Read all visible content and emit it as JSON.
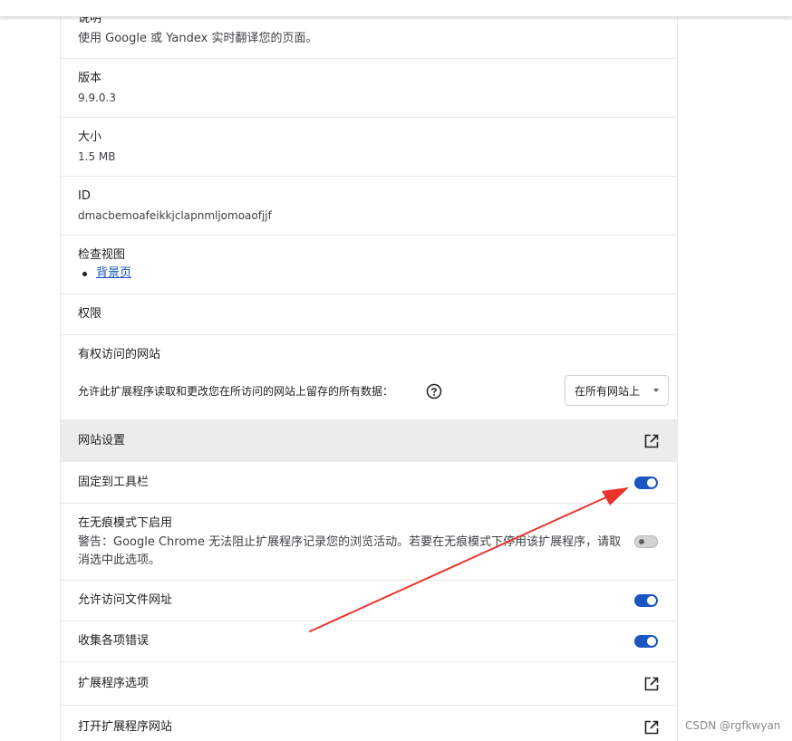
{
  "description": {
    "label": "说明",
    "value": "使用 Google 或 Yandex 实时翻译您的页面。"
  },
  "version": {
    "label": "版本",
    "value": "9.9.0.3"
  },
  "size": {
    "label": "大小",
    "value": "1.5 MB"
  },
  "id": {
    "label": "ID",
    "value": "dmacbemoafeikkjclapnmljomoaofjjf"
  },
  "inspect_views": {
    "label": "检查视图",
    "link": "背景页"
  },
  "permissions": {
    "label": "权限"
  },
  "site_access": {
    "label": "有权访问的网站",
    "desc": "允许此扩展程序读取和更改您在所访问的网站上留存的所有数据：",
    "select_value": "在所有网站上"
  },
  "site_settings": {
    "label": "网站设置"
  },
  "pin_toolbar": {
    "label": "固定到工具栏",
    "enabled": true
  },
  "incognito": {
    "label": "在无痕模式下启用",
    "warning_line1": "警告：Google Chrome 无法阻止扩展程序记录您的浏览活动。若要在无痕模式下停用该扩展程序，请取",
    "warning_line2": "消选中此选项。",
    "enabled": false
  },
  "file_urls": {
    "label": "允许访问文件网址",
    "enabled": true
  },
  "collect_errors": {
    "label": "收集各项错误",
    "enabled": true
  },
  "extension_options": {
    "label": "扩展程序选项"
  },
  "open_website": {
    "label": "打开扩展程序网站"
  },
  "watermark": "CSDN @rgfkwyan",
  "colors": {
    "accent": "#1a56c2",
    "arrow": "#e8342a",
    "hover_row": "#ececec"
  }
}
